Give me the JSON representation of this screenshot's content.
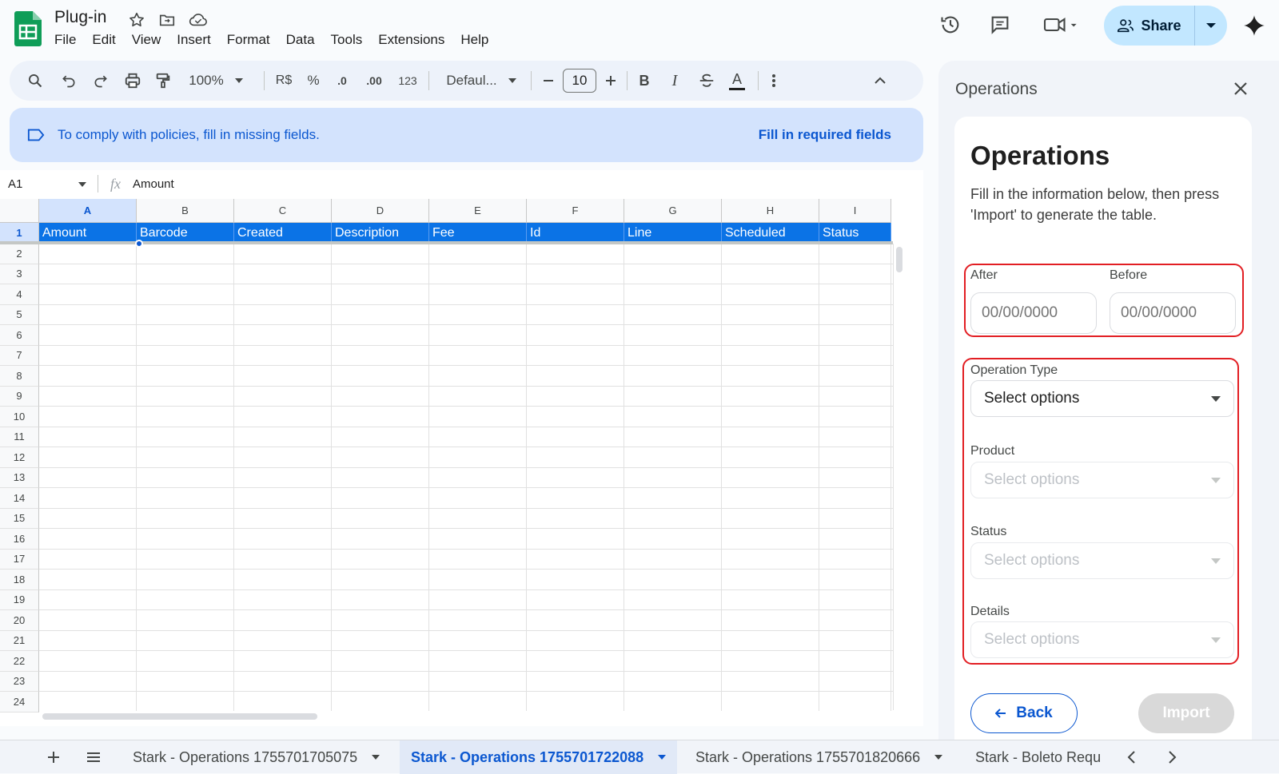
{
  "app": {
    "doc_title": "Plug-in",
    "menu": [
      "File",
      "Edit",
      "View",
      "Insert",
      "Format",
      "Data",
      "Tools",
      "Extensions",
      "Help"
    ],
    "share_label": "Share"
  },
  "toolbar": {
    "zoom": "100%",
    "currency": "R$",
    "percent": "%",
    "decrease_decimal": ".0",
    "increase_decimal": ".00",
    "number_format": "123",
    "font": "Defaul...",
    "font_size": "10",
    "bold": "B",
    "italic": "I",
    "text_color": "A"
  },
  "notice": {
    "text": "To comply with policies, fill in missing fields.",
    "action": "Fill in required fields"
  },
  "formula_bar": {
    "cell_ref": "A1",
    "fx": "fx",
    "value": "Amount"
  },
  "grid": {
    "columns": [
      "A",
      "B",
      "C",
      "D",
      "E",
      "F",
      "G",
      "H",
      "I"
    ],
    "header_row": [
      "Amount",
      "Barcode",
      "Created",
      "Description",
      "Fee",
      "Id",
      "Line",
      "Scheduled",
      "Status"
    ],
    "row_numbers": [
      "1",
      "2",
      "3",
      "4",
      "5",
      "6",
      "7",
      "8",
      "9",
      "10",
      "11",
      "12",
      "13",
      "14",
      "15",
      "16",
      "17",
      "18",
      "19",
      "20",
      "21",
      "22",
      "23",
      "24"
    ]
  },
  "sheet_tabs": [
    {
      "label": "Stark - Operations 1755701705075",
      "active": false
    },
    {
      "label": "Stark - Operations 1755701722088",
      "active": true
    },
    {
      "label": "Stark - Operations 1755701820666",
      "active": false
    },
    {
      "label": "Stark - Boleto Requ",
      "active": false
    }
  ],
  "panel": {
    "title": "Operations",
    "heading": "Operations",
    "description": "Fill in the information below, then press 'Import' to generate the table.",
    "after_label": "After",
    "before_label": "Before",
    "date_placeholder": "00/00/0000",
    "operation_type_label": "Operation Type",
    "product_label": "Product",
    "status_label": "Status",
    "details_label": "Details",
    "select_placeholder": "Select options",
    "back_label": "Back",
    "import_label": "Import",
    "highlight_color": "#e21e23"
  }
}
